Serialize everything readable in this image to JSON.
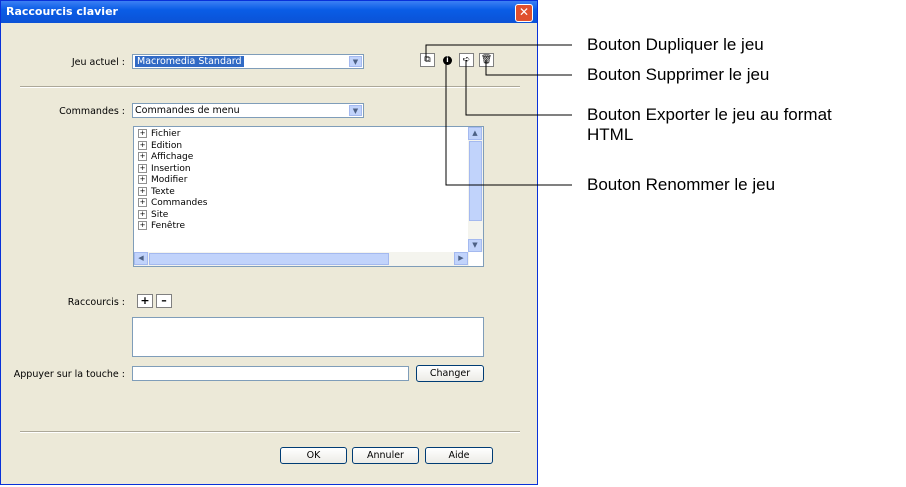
{
  "dialog": {
    "title": "Raccourcis clavier",
    "close_icon": "close-icon",
    "jeu_label": "Jeu actuel :",
    "jeu_value": "Macromedia Standard",
    "icons": {
      "duplicate": "duplicate-icon",
      "rename": "rename-icon",
      "export": "export-html-icon",
      "delete": "trash-icon"
    },
    "commandes_label": "Commandes :",
    "commandes_value": "Commandes de menu",
    "tree_items": [
      "Fichier",
      "Edition",
      "Affichage",
      "Insertion",
      "Modifier",
      "Texte",
      "Commandes",
      "Site",
      "Fenêtre"
    ],
    "raccourcis_label": "Raccourcis :",
    "add_symbol": "+",
    "remove_symbol": "–",
    "touche_label": "Appuyer sur la touche :",
    "touche_value": "",
    "changer_label": "Changer",
    "ok_label": "OK",
    "annuler_label": "Annuler",
    "aide_label": "Aide"
  },
  "callouts": {
    "duplicate": "Bouton Dupliquer le jeu",
    "delete": "Bouton Supprimer le jeu",
    "export_line1": "Bouton Exporter le jeu au format",
    "export_line2": "HTML",
    "rename": "Bouton Renommer le jeu"
  },
  "colors": {
    "title_bar": "#0a5de6",
    "dialog_bg": "#ece9d8",
    "selection": "#316ac5"
  }
}
